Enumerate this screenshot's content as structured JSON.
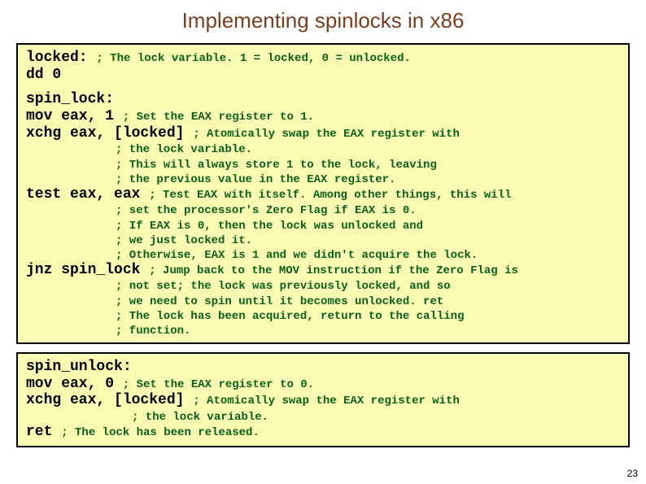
{
  "title": "Implementing spinlocks in x86",
  "page": "23",
  "box1": {
    "l1": {
      "asm": "locked: ",
      "cmt": "; The lock variable. 1 = locked, 0 = unlocked."
    },
    "l2": {
      "asm": "dd 0"
    },
    "l3": {
      "asm": "spin_lock:"
    },
    "l4": {
      "asm": "mov eax, 1 ",
      "cmt": "; Set the EAX register to 1."
    },
    "l5": {
      "asm": "xchg eax, [locked] ",
      "cmt": "; Atomically swap the EAX register with"
    },
    "l6": {
      "cmt": "; the lock variable."
    },
    "l7": {
      "cmt": "; This will always store 1 to the lock, leaving"
    },
    "l8": {
      "cmt": "; the previous value in the EAX register."
    },
    "l9": {
      "asm": "test eax, eax ",
      "cmt": "; Test EAX with itself. Among other things, this will"
    },
    "l10": {
      "cmt": "; set the processor's Zero Flag if EAX is 0."
    },
    "l11": {
      "cmt": "; If EAX is 0, then the lock was unlocked and"
    },
    "l12": {
      "cmt": "; we just locked it."
    },
    "l13": {
      "cmt": "; Otherwise, EAX is 1 and we didn't acquire the lock."
    },
    "l14": {
      "asm": "jnz spin_lock ",
      "cmt": "; Jump back to the MOV instruction if the Zero Flag is"
    },
    "l15": {
      "cmt": "; not set; the lock was previously locked, and so"
    },
    "l16": {
      "cmt": "; we need to spin until it becomes unlocked. ret"
    },
    "l17": {
      "cmt": "; The lock has been acquired, return to the calling"
    },
    "l18": {
      "cmt": "; function."
    }
  },
  "box2": {
    "l1": {
      "asm": "spin_unlock:"
    },
    "l2": {
      "asm": "mov eax, 0 ",
      "cmt": "; Set the EAX register to 0."
    },
    "l3": {
      "asm": "xchg eax, [locked] ",
      "cmt": "; Atomically swap the EAX register with"
    },
    "l4": {
      "cmt": "; the lock variable."
    },
    "l5": {
      "asm": "ret ",
      "cmt": "; The lock has been released."
    }
  }
}
